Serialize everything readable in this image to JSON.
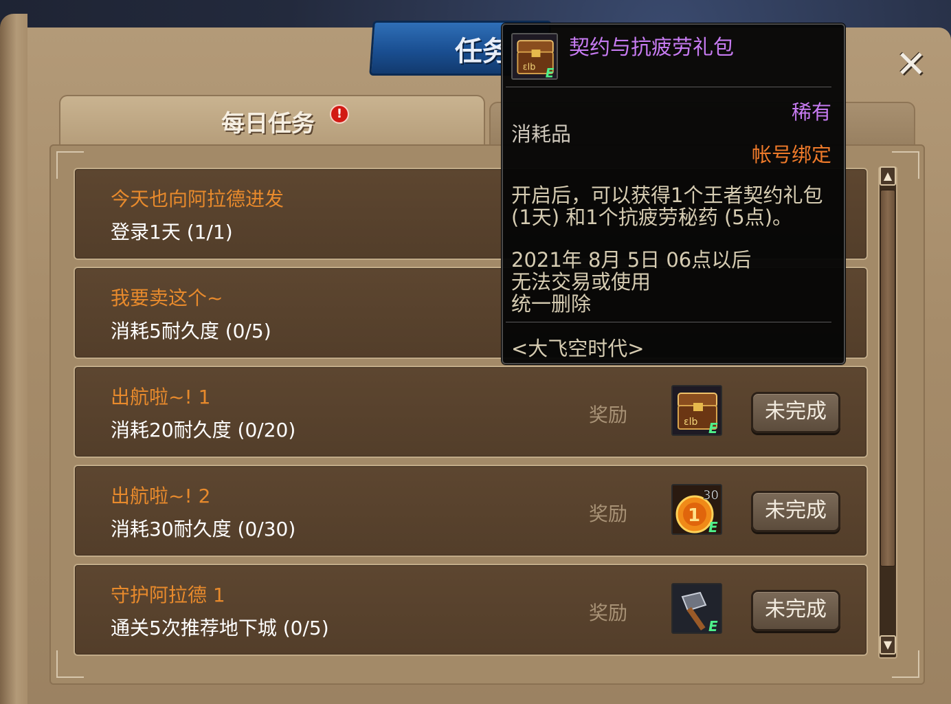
{
  "window": {
    "title": "任务",
    "close_glyph": "✕"
  },
  "tabs": [
    {
      "label": "每日任务",
      "alert": "!",
      "active": true
    },
    {
      "label": "",
      "active": false
    }
  ],
  "tasks": [
    {
      "title": "今天也向阿拉德进发",
      "desc": "登录1天 (1/1)"
    },
    {
      "title": "我要卖这个~",
      "desc": "消耗5耐久度 (0/5)"
    },
    {
      "title": "出航啦~! 1",
      "desc": "消耗20耐久度 (0/20)",
      "reward_label": "奖励",
      "reward_icon": "contract-gift-box-icon",
      "status": "未完成"
    },
    {
      "title": "出航啦~! 2",
      "desc": "消耗30耐久度 (0/30)",
      "reward_label": "奖励",
      "reward_icon": "gold-coin-icon",
      "reward_badge": "30",
      "status": "未完成"
    },
    {
      "title": "守护阿拉德 1",
      "desc": "通关5次推荐地下城 (0/5)",
      "reward_label": "奖励",
      "reward_icon": "hammer-icon",
      "status": "未完成"
    }
  ],
  "tooltip": {
    "item_name": "契约与抗疲劳礼包",
    "rarity": "稀有",
    "item_type": "消耗品",
    "binding": "帐号绑定",
    "description_lines": [
      "开启后，可以获得1个王者契约礼包",
      "(1天) 和1个抗疲劳秘药 (5点)。"
    ],
    "expiry_lines": [
      "2021年 8月 5日 06点以后",
      "无法交易或使用",
      "统一删除"
    ],
    "source": "<大飞空时代>",
    "colors": {
      "rarity": "#c77bf2",
      "binding": "#ef7a2a",
      "body": "#d6ccb2"
    }
  },
  "item_grade_mark": "E",
  "colors": {
    "task_title": "#e88a2c",
    "task_desc": "#ffffff",
    "ribbon": "#1a4f92",
    "parchment": "#a68c6a"
  }
}
